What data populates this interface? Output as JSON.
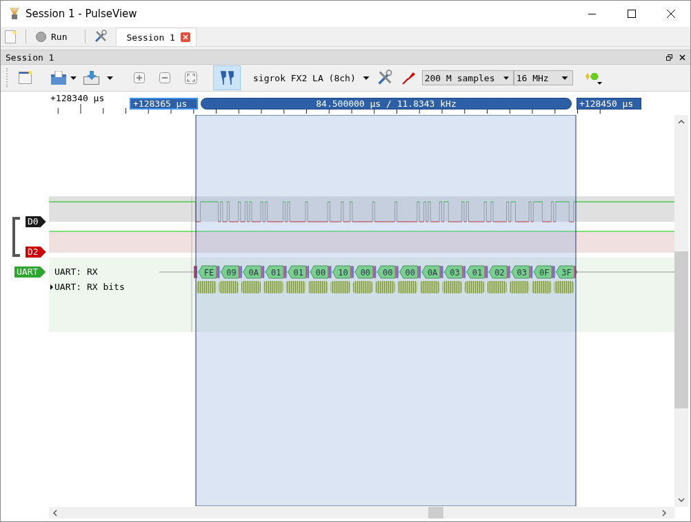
{
  "window": {
    "title": "Session 1 - PulseView"
  },
  "main_toolbar": {
    "run_label": "Run",
    "tabs": [
      {
        "label": "Session 1",
        "selected": true
      }
    ]
  },
  "dock": {
    "title": "Session 1"
  },
  "toolbar": {
    "device": "sigrok FX2 LA (8ch)",
    "sample_count": "200 M samples",
    "sample_rate": "16 MHz",
    "cursors_on": true
  },
  "ruler": {
    "labels": [
      "+128340 μs"
    ]
  },
  "cursors": {
    "left": "+128365 μs",
    "span": "84.500000 μs / 11.8343 kHz",
    "right": "+128450 μs"
  },
  "channels": [
    {
      "name": "D0",
      "color": "#1a1a1a"
    },
    {
      "name": "D2",
      "color": "#cc0000"
    }
  ],
  "decoder": {
    "name": "UART",
    "color": "#2ea52e",
    "rows": [
      {
        "label": "UART: RX",
        "expanded": true
      },
      {
        "label": "UART: RX bits",
        "expanded": false
      }
    ],
    "annotations": [
      "FE",
      "09",
      "0A",
      "01",
      "01",
      "00",
      "10",
      "00",
      "00",
      "00",
      "0A",
      "03",
      "01",
      "02",
      "03",
      "0F",
      "3F"
    ]
  }
}
